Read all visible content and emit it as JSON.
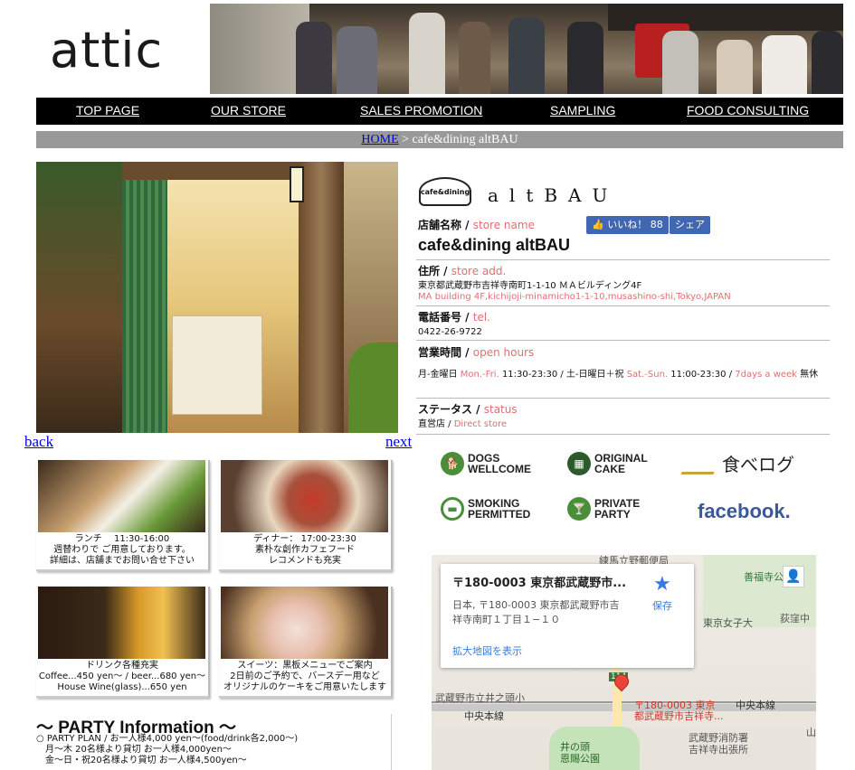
{
  "header": {
    "logo": "attic"
  },
  "nav": {
    "items": [
      "TOP PAGE",
      "OUR STORE",
      "SALES PROMOTION",
      "SAMPLING",
      "FOOD CONSULTING"
    ]
  },
  "breadcrumb": {
    "home": "HOME",
    "current": " > cafe&dining altBAU"
  },
  "gallery": {
    "back": "back",
    "next": "next"
  },
  "cards": [
    {
      "caption": "ランチ　 11:30-16:00\n週替わりで ご用意しております。\n詳細は、店舗までお問い合せ下さい"
    },
    {
      "caption": "ディナー：  17:00-23:30\n素朴な創作カフェフード\nレコメンドも充実"
    },
    {
      "caption": "ドリンク各種充実\nCoffee...450 yen〜 / beer...680 yen〜\nHouse Wine(glass)...650 yen"
    },
    {
      "caption": "スイーツ：黒板メニューでご案内\n2日前のご予約で、バースデー用など\nオリジナルのケーキをご用意いたします"
    }
  ],
  "party": {
    "title": "〜 PARTY Information 〜",
    "text": "○ PARTY PLAN / お一人様4,000 yen〜(food/drink各2,000〜)\n　月〜木 20名様より貸切 お一人様4,000yen〜\n　金〜日・祝20名様より貸切 お一人様4,500yen〜"
  },
  "store": {
    "brand_badge": "cafe&dining",
    "brand_logo": "altBAU",
    "name_label": "店舗名称 / ",
    "name_label_en": "store name",
    "like_label": "いいね！ 88",
    "share_label": "シェア",
    "name": "cafe&dining altBAU",
    "address_label": "住所 / ",
    "address_label_en": "store add.",
    "address_jp": "東京都武蔵野市吉祥寺南町1-1-10 ＭＡビルディング4F",
    "address_en": "MA building 4F,kichijoji-minamicho1-1-10,musashino-shi,Tokyo,JAPAN",
    "tel_label": "電話番号 / ",
    "tel_label_en": "tel.",
    "tel": "0422-26-9722",
    "hours_label": "営業時間 / ",
    "hours_label_en": "open hours",
    "hours_p1": "月-金曜日 ",
    "hours_p2": "Mon.-Fri.",
    "hours_p3": "  11:30-23:30 / 土-日曜日＋祝 ",
    "hours_p4": "Sat.-Sun.",
    "hours_p5": "  11:00-23:30 / ",
    "hours_p6": "7days a week",
    "hours_p7": "  無休",
    "status_label": "ステータス / ",
    "status_label_en": "status",
    "status_jp": "直営店 / ",
    "status_en": "Direct store"
  },
  "features": [
    {
      "label": "DOGS\nWELLCOME",
      "icon": "dog-icon",
      "color": "#4a8e3a"
    },
    {
      "label": "ORIGINAL\nCAKE",
      "icon": "cake-icon",
      "color": "#4a8e3a"
    },
    {
      "label": "食べログ",
      "icon": "tabelog-icon",
      "color": "#222222"
    },
    {
      "label": "SMOKING\nPERMITTED",
      "icon": "smoking-icon",
      "color": "#4a8e3a"
    },
    {
      "label": "PRIVATE\nPARTY",
      "icon": "cocktail-icon",
      "color": "#4a8e3a"
    },
    {
      "label": "facebook.",
      "icon": "facebook-icon",
      "color": "#3b5998"
    }
  ],
  "map": {
    "popup_title": "〒180-0003 東京都武蔵野市...",
    "popup_addr": "日本, 〒180-0003 東京都武蔵野市吉\n祥寺南町１丁目１−１０",
    "popup_link": "拡大地図を表示",
    "save_label": "保存",
    "labels": [
      "練馬立野郵便局",
      "善福寺公",
      "東京女子大",
      "荻窪中",
      "中央本線",
      "中央本線",
      "武蔵野市立井之頭小",
      "武蔵野消防署\n吉祥寺出張所",
      "井の頭\n恩賜公園",
      "〒180-0003 東京\n都武蔵野市吉祥寺...",
      "114",
      "山"
    ]
  }
}
